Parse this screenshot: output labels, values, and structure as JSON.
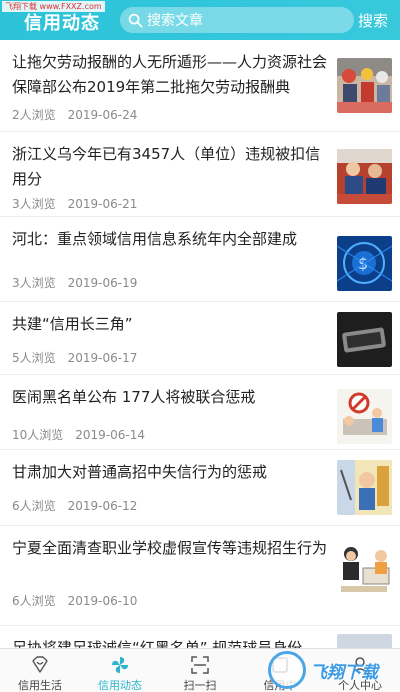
{
  "watermark_top": "飞翔下载 www.FXXZ.com",
  "header": {
    "title": "信用动态",
    "search_placeholder": "搜索文章",
    "search_button": "搜索",
    "accent_color": "#2cc3d8"
  },
  "articles": [
    {
      "title": "让拖欠劳动报酬的人无所遁形——人力资源社会保障部公布2019年第二批拖欠劳动报酬典",
      "views": "2人浏览",
      "date": "2019-06-24"
    },
    {
      "title": "浙江义乌今年已有3457人（单位）违规被扣信用分",
      "views": "3人浏览",
      "date": "2019-06-21"
    },
    {
      "title": "河北：重点领域信用信息系统年内全部建成",
      "views": "3人浏览",
      "date": "2019-06-19"
    },
    {
      "title": "共建“信用长三角”",
      "views": "5人浏览",
      "date": "2019-06-17"
    },
    {
      "title": "医闹黑名单公布 177人将被联合惩戒",
      "views": "10人浏览",
      "date": "2019-06-14"
    },
    {
      "title": "甘肃加大对普通高招中失信行为的惩戒",
      "views": "6人浏览",
      "date": "2019-06-12"
    },
    {
      "title": "宁夏全面清查职业学校虚假宣传等违规招生行为",
      "views": "6人浏览",
      "date": "2019-06-10"
    },
    {
      "title": "足协将建足球诚信“红黑名单” 规范球员身份",
      "views": "",
      "date": ""
    }
  ],
  "tabs": [
    {
      "label": "信用生活",
      "icon": "diamond-heart-icon"
    },
    {
      "label": "信用动态",
      "icon": "pinwheel-icon"
    },
    {
      "label": "扫一扫",
      "icon": "scan-icon"
    },
    {
      "label": "信用中",
      "icon": "credit-icon"
    },
    {
      "label": "个人中心",
      "icon": "person-icon"
    }
  ],
  "watermark_bottom": "飞翔下载"
}
